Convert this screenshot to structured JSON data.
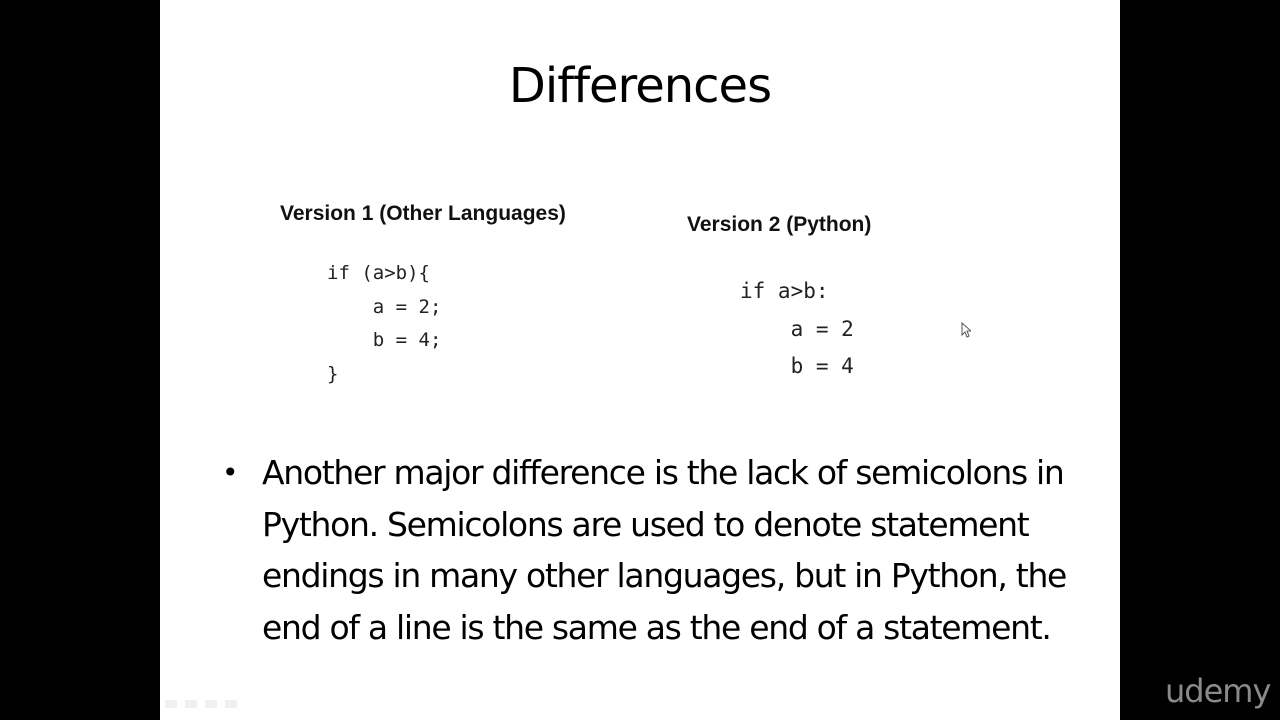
{
  "slide": {
    "title": "Differences",
    "version1": {
      "heading": "Version 1 (Other Languages)",
      "code": "if (a>b){\n    a = 2;\n    b = 4;\n}"
    },
    "version2": {
      "heading": "Version 2 (Python)",
      "code": "if a>b:\n    a = 2\n    b = 4"
    },
    "bullet": {
      "marker": "•",
      "text": "Another major difference is the lack of semicolons in Python. Semicolons are used to denote statement endings in many other languages, but in Python, the end of a line is the same as the end of a statement."
    }
  },
  "watermark": {
    "logo_text": "udemy"
  },
  "toolbar": {
    "icons": [
      "previous-icon",
      "pen-icon",
      "slides-icon",
      "next-icon"
    ]
  }
}
